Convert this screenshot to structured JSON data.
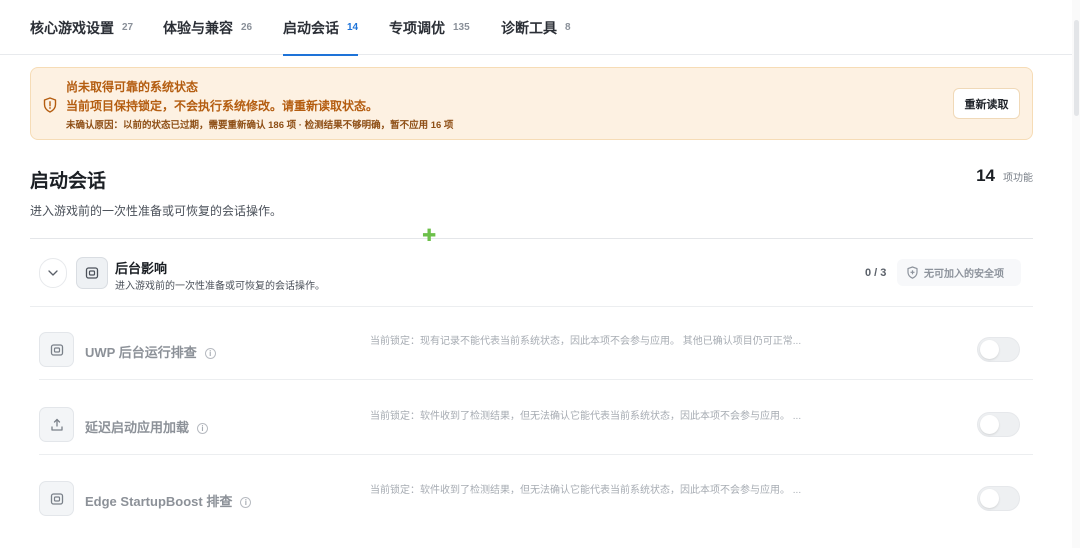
{
  "tabs": [
    {
      "label": "核心游戏设置",
      "count": "27"
    },
    {
      "label": "体验与兼容",
      "count": "26"
    },
    {
      "label": "启动会话",
      "count": "14"
    },
    {
      "label": "专项调优",
      "count": "135"
    },
    {
      "label": "诊断工具",
      "count": "8"
    }
  ],
  "banner": {
    "title": "尚未取得可靠的系统状态",
    "message": "当前项目保持锁定，不会执行系统修改。请重新读取状态。",
    "reason": "未确认原因：以前的状态已过期，需要重新确认 186 项 · 检测结果不够明确，暂不应用 16 项",
    "reload_label": "重新读取"
  },
  "section": {
    "title": "启动会话",
    "description": "进入游戏前的一次性准备或可恢复的会话操作。",
    "count": "14",
    "count_unit": "项功能"
  },
  "group": {
    "title": "后台影响",
    "description": "进入游戏前的一次性准备或可恢复的会话操作。",
    "ratio": "0 / 3",
    "safe_label": "无可加入的安全项"
  },
  "rows": [
    {
      "title": "UWP 后台运行排查",
      "desc": "当前锁定：现有记录不能代表当前系统状态，因此本项不会参与应用。 其他已确认项目仍可正常...",
      "enabled": false,
      "icon": "panel-icon"
    },
    {
      "title": "延迟启动应用加载",
      "desc": "当前锁定：软件收到了检测结果，但无法确认它能代表当前系统状态，因此本项不会参与应用。 ...",
      "enabled": false,
      "icon": "upload-icon"
    },
    {
      "title": "Edge StartupBoost 排查",
      "desc": "当前锁定：软件收到了检测结果，但无法确认它能代表当前系统状态，因此本项不会参与应用。 ...",
      "enabled": false,
      "icon": "panel-icon"
    }
  ],
  "colors": {
    "accent": "#1e73d8",
    "warning_bg": "#fdf1e2",
    "warning_text": "#b45d10"
  }
}
